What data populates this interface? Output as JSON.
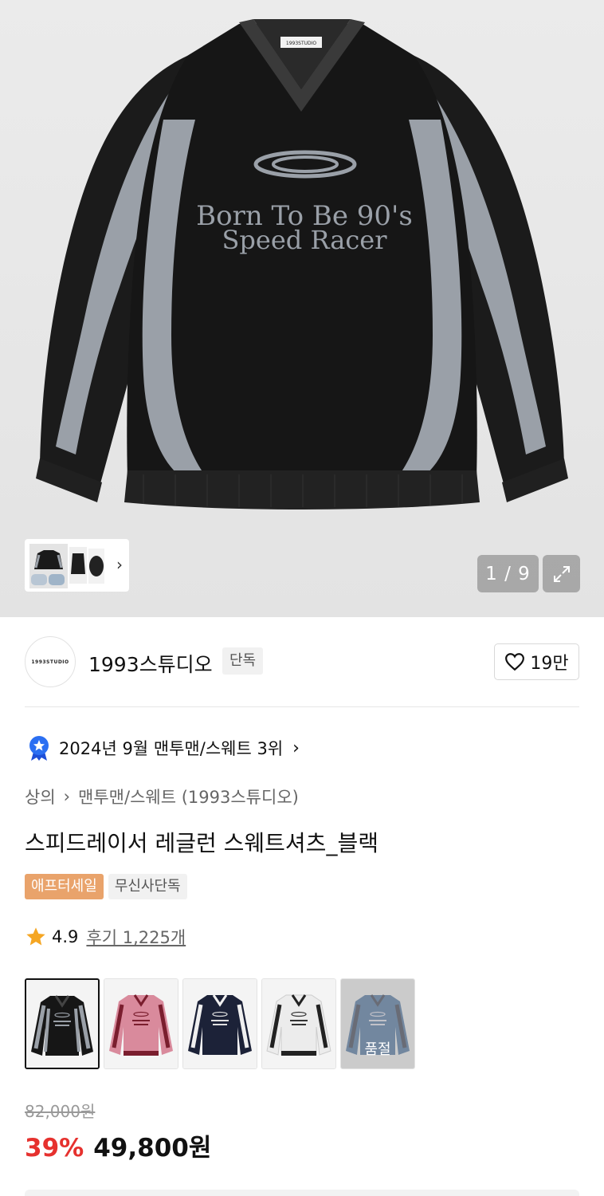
{
  "gallery": {
    "counter": "1 / 9",
    "expand_icon": "expand-icon"
  },
  "shirt_print": {
    "line1": "Born To Be 90's",
    "line2": "Speed Racer",
    "neck_label": "1993STUDIO"
  },
  "brand": {
    "logo_text": "1993STUDIO",
    "name": "1993스튜디오",
    "tag": "단독",
    "likes": "19만"
  },
  "ranking": {
    "text": "2024년 9월 맨투맨/스웨트 3위"
  },
  "breadcrumb": {
    "category": "상의",
    "subcategory": "맨투맨/스웨트 (1993스튜디오)"
  },
  "product": {
    "title": "스피드레이서 레글런 스웨트셔츠_블랙",
    "badges": [
      "애프터세일",
      "무신사단독"
    ]
  },
  "rating": {
    "score": "4.9",
    "reviews": "후기 1,225개"
  },
  "options": {
    "soldout_label": "품절"
  },
  "price": {
    "original": "82,000원",
    "discount": "39%",
    "final": "49,800원"
  },
  "colors": {
    "accent_red": "#e6312e",
    "sale_badge": "#e9a36b"
  }
}
